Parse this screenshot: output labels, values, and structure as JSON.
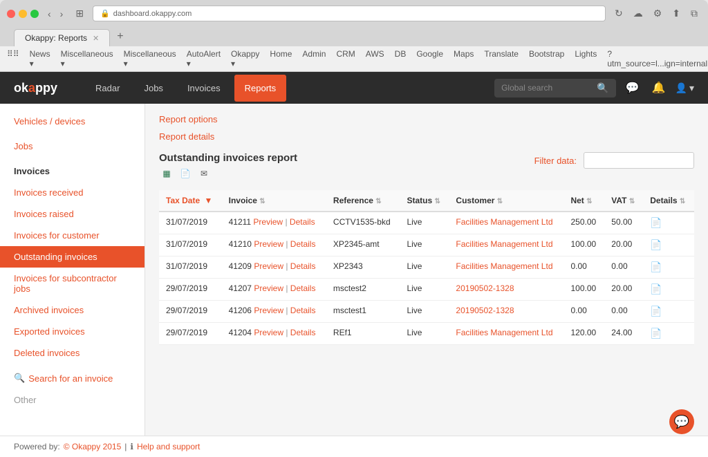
{
  "browser": {
    "address": "dashboard.okappy.com",
    "tab_title": "Okappy: Reports",
    "bookmarks": [
      "News",
      "Miscellaneous",
      "Miscellaneous",
      "AutoAlert",
      "Okappy",
      "Home",
      "Admin",
      "CRM",
      "AWS",
      "DB",
      "Google",
      "Maps",
      "Translate",
      "Bootstrap",
      "Lights",
      "?utm_source=l...ign=internal"
    ]
  },
  "topnav": {
    "logo": "okappy",
    "links": [
      "Radar",
      "Jobs",
      "Invoices",
      "Reports"
    ],
    "active_link": "Reports",
    "search_placeholder": "Global search",
    "search_label": "Global search"
  },
  "sidebar": {
    "sections": [
      {
        "label": "Vehicles / devices",
        "items": []
      },
      {
        "label": "Jobs",
        "items": []
      },
      {
        "label": "Invoices",
        "items": [
          {
            "label": "Invoices received",
            "active": false
          },
          {
            "label": "Invoices raised",
            "active": false
          },
          {
            "label": "Invoices for customer",
            "active": false
          },
          {
            "label": "Outstanding invoices",
            "active": true
          },
          {
            "label": "Invoices for subcontractor jobs",
            "active": false
          },
          {
            "label": "Archived invoices",
            "active": false
          },
          {
            "label": "Exported invoices",
            "active": false
          },
          {
            "label": "Deleted invoices",
            "active": false
          }
        ]
      }
    ],
    "search_label": "Search for an invoice",
    "other_label": "Other"
  },
  "main": {
    "breadcrumb": "Report options",
    "section_title": "Report details",
    "report_title": "Outstanding invoices report",
    "filter_label": "Filter data:",
    "filter_placeholder": "",
    "table": {
      "columns": [
        {
          "label": "Tax Date",
          "sortable": true,
          "sorted": true
        },
        {
          "label": "Invoice",
          "sortable": true
        },
        {
          "label": "Reference",
          "sortable": true
        },
        {
          "label": "Status",
          "sortable": true
        },
        {
          "label": "Customer",
          "sortable": true
        },
        {
          "label": "Net",
          "sortable": true
        },
        {
          "label": "VAT",
          "sortable": true
        },
        {
          "label": "Details",
          "sortable": true
        }
      ],
      "rows": [
        {
          "tax_date": "31/07/2019",
          "invoice_id": "41211",
          "invoice_preview": "Preview",
          "invoice_details": "Details",
          "reference": "CCTV1535-bkd",
          "status": "Live",
          "customer": "Facilities Management Ltd",
          "net": "250.00",
          "vat": "50.00",
          "has_doc": true
        },
        {
          "tax_date": "31/07/2019",
          "invoice_id": "41210",
          "invoice_preview": "Preview",
          "invoice_details": "Details",
          "reference": "XP2345-amt",
          "status": "Live",
          "customer": "Facilities Management Ltd",
          "net": "100.00",
          "vat": "20.00",
          "has_doc": true
        },
        {
          "tax_date": "31/07/2019",
          "invoice_id": "41209",
          "invoice_preview": "Preview",
          "invoice_details": "Details",
          "reference": "XP2343",
          "status": "Live",
          "customer": "Facilities Management Ltd",
          "net": "0.00",
          "vat": "0.00",
          "has_doc": true
        },
        {
          "tax_date": "29/07/2019",
          "invoice_id": "41207",
          "invoice_preview": "Preview",
          "invoice_details": "Details",
          "reference": "msctest2",
          "status": "Live",
          "customer": "20190502-1328",
          "net": "100.00",
          "vat": "20.00",
          "has_doc": true
        },
        {
          "tax_date": "29/07/2019",
          "invoice_id": "41206",
          "invoice_preview": "Preview",
          "invoice_details": "Details",
          "reference": "msctest1",
          "status": "Live",
          "customer": "20190502-1328",
          "net": "0.00",
          "vat": "0.00",
          "has_doc": true
        },
        {
          "tax_date": "29/07/2019",
          "invoice_id": "41204",
          "invoice_preview": "Preview",
          "invoice_details": "Details",
          "reference": "REf1",
          "status": "Live",
          "customer": "Facilities Management Ltd",
          "net": "120.00",
          "vat": "24.00",
          "has_doc": true
        }
      ]
    }
  },
  "footer": {
    "powered_by": "Powered by:",
    "company": "© Okappy 2015",
    "help_label": "Help and support"
  }
}
